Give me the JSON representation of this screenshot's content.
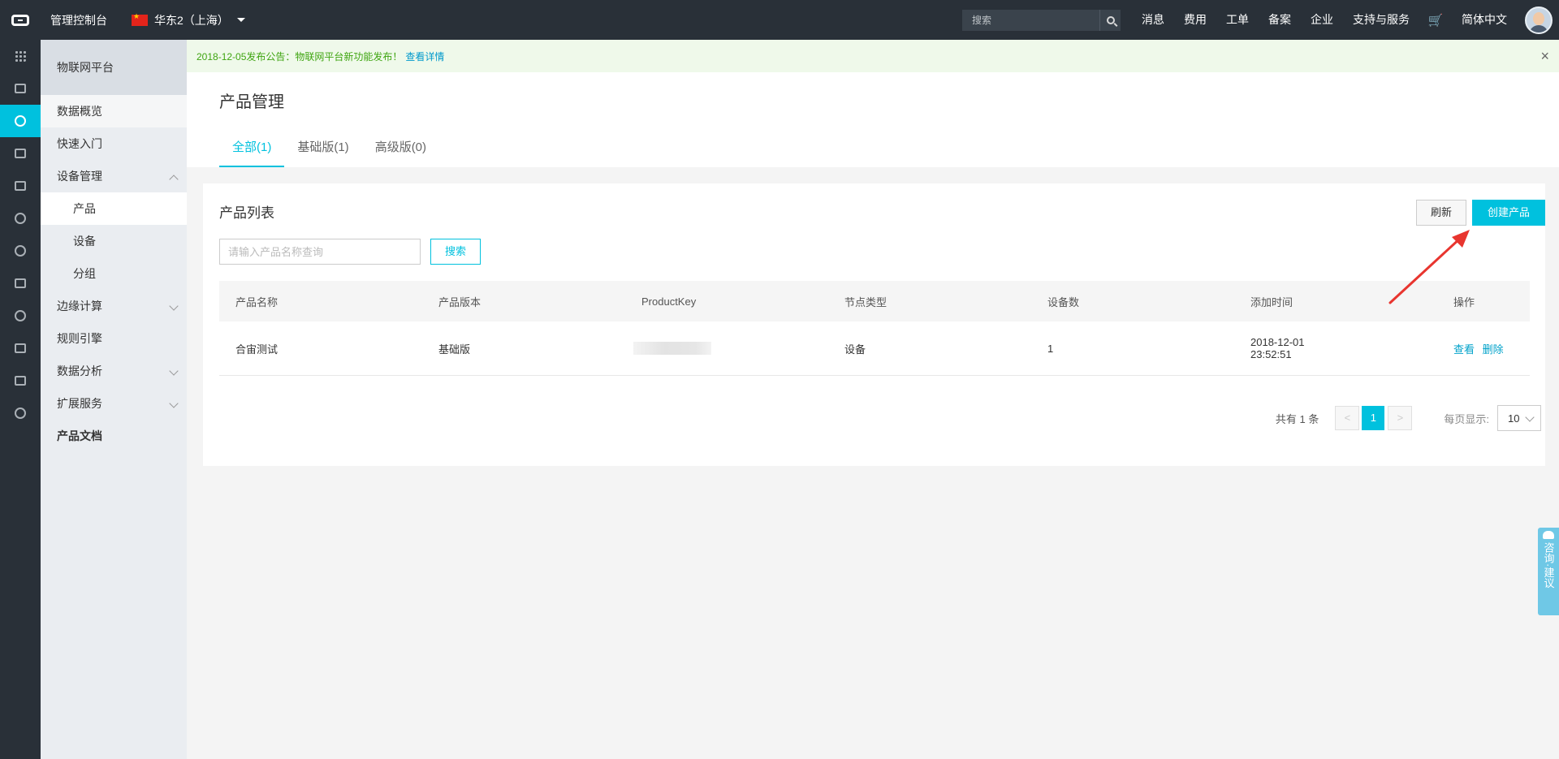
{
  "topbar": {
    "console_title": "管理控制台",
    "region": "华东2（上海）",
    "search_placeholder": "搜索",
    "links": [
      "消息",
      "费用",
      "工单",
      "备案",
      "企业",
      "支持与服务"
    ],
    "language": "简体中文"
  },
  "sidebar": {
    "title": "物联网平台",
    "items": {
      "overview": "数据概览",
      "quickstart": "快速入门",
      "device_mgmt": "设备管理",
      "product": "产品",
      "device": "设备",
      "group": "分组",
      "edge": "边缘计算",
      "rules": "规则引擎",
      "analysis": "数据分析",
      "extension": "扩展服务",
      "docs": "产品文档"
    }
  },
  "announcement": {
    "text": "2018-12-05发布公告：物联网平台新功能发布！",
    "link": "查看详情"
  },
  "page": {
    "title": "产品管理",
    "tabs": [
      "全部(1)",
      "基础版(1)",
      "高级版(0)"
    ]
  },
  "card": {
    "title": "产品列表",
    "refresh": "刷新",
    "create": "创建产品",
    "query_placeholder": "请输入产品名称查询",
    "search": "搜索"
  },
  "table": {
    "headers": [
      "产品名称",
      "产品版本",
      "ProductKey",
      "节点类型",
      "设备数",
      "添加时间",
      "操作"
    ],
    "rows": [
      {
        "name": "合宙测试",
        "version": "基础版",
        "node_type": "设备",
        "device_count": "1",
        "added_date": "2018-12-01",
        "added_time": "23:52:51",
        "view": "查看",
        "delete": "删除"
      }
    ]
  },
  "pagination": {
    "total": "共有 1 条",
    "prev": "<",
    "current": "1",
    "next": ">",
    "per_page_label": "每页显示:",
    "page_size": "10"
  },
  "consult": "咨询·建议",
  "colors": {
    "accent": "#00c1de",
    "topbar": "#293038",
    "annotation_arrow": "#e8352f"
  }
}
